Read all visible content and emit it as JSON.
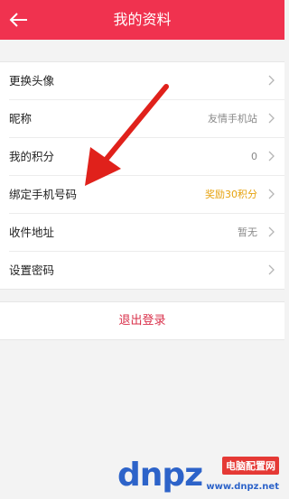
{
  "header": {
    "title": "我的资料"
  },
  "rows": [
    {
      "label": "更换头像",
      "value": ""
    },
    {
      "label": "昵称",
      "value": "友情手机站"
    },
    {
      "label": "我的积分",
      "value": "0"
    },
    {
      "label": "绑定手机号码",
      "value": "奖励30积分"
    },
    {
      "label": "收件地址",
      "value": "暂无"
    },
    {
      "label": "设置密码",
      "value": ""
    }
  ],
  "logout_label": "退出登录",
  "watermark": {
    "logo_text": "dnpz",
    "site_name": "电脑配置网",
    "url": "www.dnpz.net"
  },
  "colors": {
    "header_bg": "#f0324f",
    "reward": "#e6a20e",
    "logout_text": "#d9304a",
    "annotation_arrow": "#e0211b"
  }
}
